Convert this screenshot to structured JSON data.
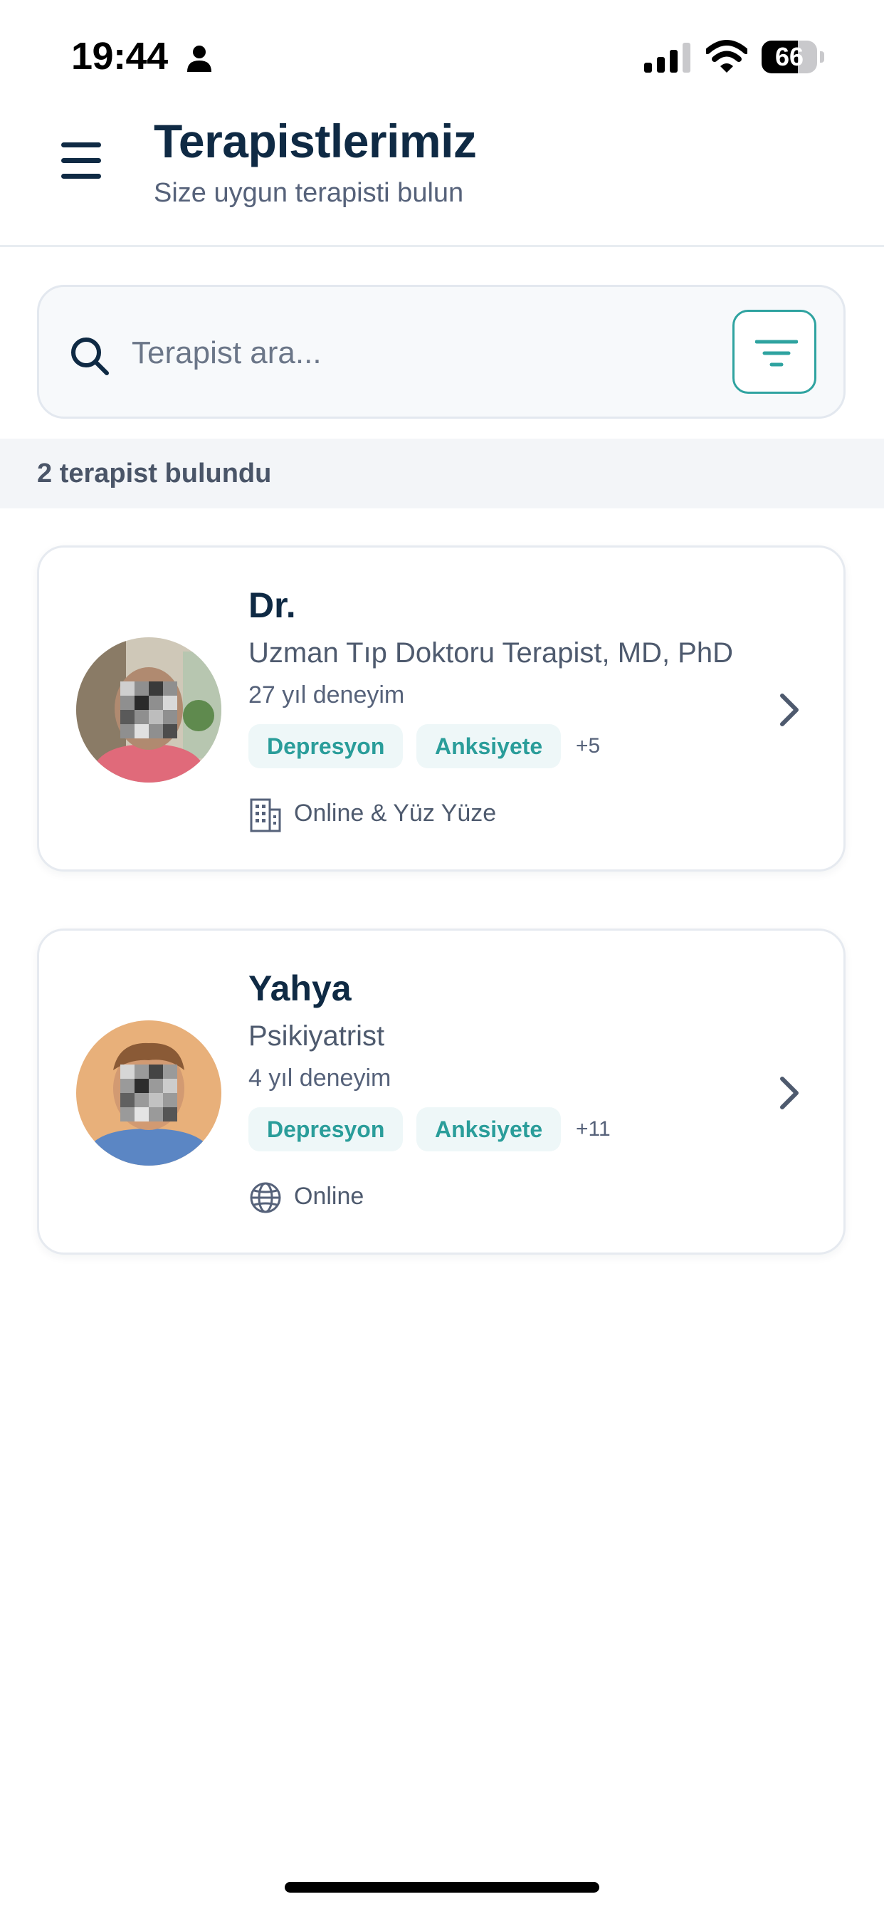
{
  "status_bar": {
    "time": "19:44",
    "battery_level": "66",
    "battery_fraction": 0.66
  },
  "header": {
    "title": "Terapistlerimiz",
    "subtitle": "Size uygun terapisti bulun"
  },
  "search": {
    "placeholder": "Terapist ara...",
    "value": ""
  },
  "results": {
    "count_text": "2 terapist bulundu"
  },
  "therapists": [
    {
      "name": "Dr.",
      "title": "Uzman Tıp Doktoru Terapist, MD, PhD",
      "experience": "27 yıl deneyim",
      "tags": [
        "Depresyon",
        "Anksiyete"
      ],
      "more_tags": "+5",
      "mode": "Online & Yüz Yüze",
      "mode_icon": "building-icon"
    },
    {
      "name": "Yahya",
      "title": "Psikiyatrist",
      "experience": "4 yıl deneyim",
      "tags": [
        "Depresyon",
        "Anksiyete"
      ],
      "more_tags": "+11",
      "mode": "Online",
      "mode_icon": "globe-icon"
    }
  ],
  "colors": {
    "primary_dark": "#0f2a44",
    "accent_teal": "#2fa3a0",
    "tag_background": "#eef7f8"
  }
}
